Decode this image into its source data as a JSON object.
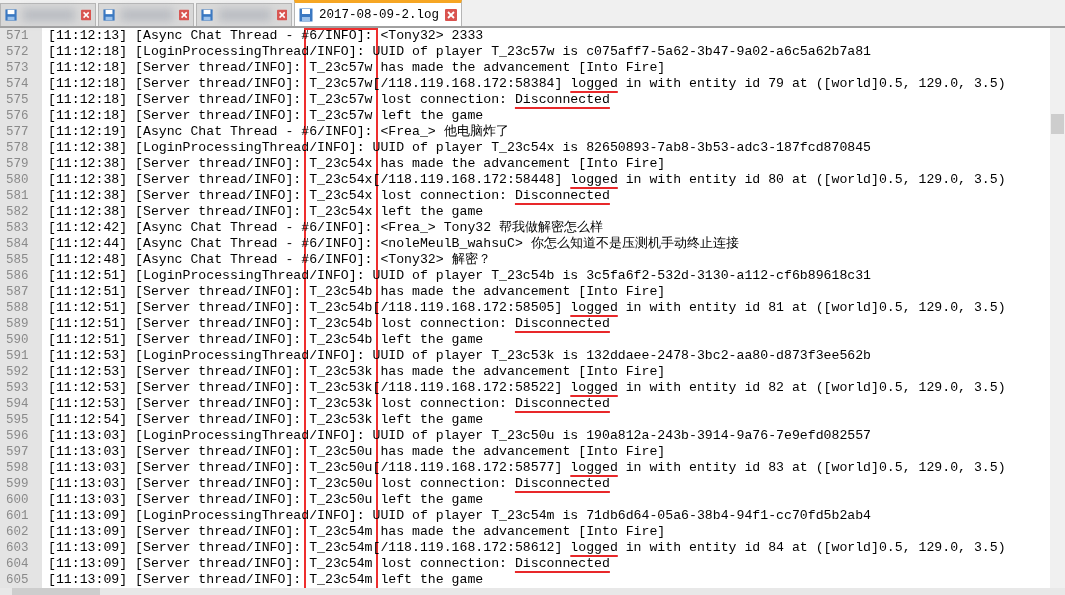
{
  "tabs": [
    {
      "selected": false
    },
    {
      "selected": false
    },
    {
      "selected": false
    },
    {
      "label": "2017-08-09-2.log",
      "selected": true
    }
  ],
  "lines": [
    {
      "n": "571",
      "kind": "plain",
      "text": "[11:12:13] [Async Chat Thread - #6/INFO]: <Tony32> 2333"
    },
    {
      "n": "572",
      "kind": "plain",
      "text": "[11:12:18] [LoginProcessingThread/INFO]: UUID of player T_23c57w is c075aff7-5a62-3b47-9a02-a6c5a62b7a81"
    },
    {
      "n": "573",
      "kind": "plain",
      "text": "[11:12:18] [Server thread/INFO]: T_23c57w has made the advancement [Into Fire]"
    },
    {
      "n": "574",
      "kind": "marked",
      "before": "[11:12:18] [Server thread/INFO]: T_23c57w[/118.119.168.172:58384] ",
      "marked": "logged",
      "after": " in with entity id 79 at ([world]0.5, 129.0, 3.5)"
    },
    {
      "n": "575",
      "kind": "marked",
      "before": "[11:12:18] [Server thread/INFO]: T_23c57w lost connection: ",
      "marked": "Disconnected"
    },
    {
      "n": "576",
      "kind": "plain",
      "text": "[11:12:18] [Server thread/INFO]: T_23c57w left the game"
    },
    {
      "n": "577",
      "kind": "plain",
      "text": "[11:12:19] [Async Chat Thread - #6/INFO]: <Frea_> 他电脑炸了"
    },
    {
      "n": "578",
      "kind": "plain",
      "text": "[11:12:38] [LoginProcessingThread/INFO]: UUID of player T_23c54x is 82650893-7ab8-3b53-adc3-187fcd870845"
    },
    {
      "n": "579",
      "kind": "plain",
      "text": "[11:12:38] [Server thread/INFO]: T_23c54x has made the advancement [Into Fire]"
    },
    {
      "n": "580",
      "kind": "marked",
      "before": "[11:12:38] [Server thread/INFO]: T_23c54x[/118.119.168.172:58448] ",
      "marked": "logged",
      "after": " in with entity id 80 at ([world]0.5, 129.0, 3.5)"
    },
    {
      "n": "581",
      "kind": "marked",
      "before": "[11:12:38] [Server thread/INFO]: T_23c54x lost connection: ",
      "marked": "Disconnected"
    },
    {
      "n": "582",
      "kind": "plain",
      "text": "[11:12:38] [Server thread/INFO]: T_23c54x left the game"
    },
    {
      "n": "583",
      "kind": "plain",
      "text": "[11:12:42] [Async Chat Thread - #6/INFO]: <Frea_> Tony32 帮我做解密怎么样"
    },
    {
      "n": "584",
      "kind": "plain",
      "text": "[11:12:44] [Async Chat Thread - #6/INFO]: <noleMeulB_wahsuC> 你怎么知道不是压测机手动终止连接"
    },
    {
      "n": "585",
      "kind": "plain",
      "text": "[11:12:48] [Async Chat Thread - #6/INFO]: <Tony32> 解密？"
    },
    {
      "n": "586",
      "kind": "plain",
      "text": "[11:12:51] [LoginProcessingThread/INFO]: UUID of player T_23c54b is 3c5fa6f2-532d-3130-a112-cf6b89618c31"
    },
    {
      "n": "587",
      "kind": "plain",
      "text": "[11:12:51] [Server thread/INFO]: T_23c54b has made the advancement [Into Fire]"
    },
    {
      "n": "588",
      "kind": "marked",
      "before": "[11:12:51] [Server thread/INFO]: T_23c54b[/118.119.168.172:58505] ",
      "marked": "logged",
      "after": " in with entity id 81 at ([world]0.5, 129.0, 3.5)"
    },
    {
      "n": "589",
      "kind": "marked",
      "before": "[11:12:51] [Server thread/INFO]: T_23c54b lost connection: ",
      "marked": "Disconnected"
    },
    {
      "n": "590",
      "kind": "plain",
      "text": "[11:12:51] [Server thread/INFO]: T_23c54b left the game"
    },
    {
      "n": "591",
      "kind": "plain",
      "text": "[11:12:53] [LoginProcessingThread/INFO]: UUID of player T_23c53k is 132ddaee-2478-3bc2-aa80-d873f3ee562b"
    },
    {
      "n": "592",
      "kind": "plain",
      "text": "[11:12:53] [Server thread/INFO]: T_23c53k has made the advancement [Into Fire]"
    },
    {
      "n": "593",
      "kind": "marked",
      "before": "[11:12:53] [Server thread/INFO]: T_23c53k[/118.119.168.172:58522] ",
      "marked": "logged",
      "after": " in with entity id 82 at ([world]0.5, 129.0, 3.5)"
    },
    {
      "n": "594",
      "kind": "marked",
      "before": "[11:12:53] [Server thread/INFO]: T_23c53k lost connection: ",
      "marked": "Disconnected"
    },
    {
      "n": "595",
      "kind": "plain",
      "text": "[11:12:54] [Server thread/INFO]: T_23c53k left the game"
    },
    {
      "n": "596",
      "kind": "plain",
      "text": "[11:13:03] [LoginProcessingThread/INFO]: UUID of player T_23c50u is 190a812a-243b-3914-9a76-7e9efd082557"
    },
    {
      "n": "597",
      "kind": "plain",
      "text": "[11:13:03] [Server thread/INFO]: T_23c50u has made the advancement [Into Fire]"
    },
    {
      "n": "598",
      "kind": "marked",
      "before": "[11:13:03] [Server thread/INFO]: T_23c50u[/118.119.168.172:58577] ",
      "marked": "logged",
      "after": " in with entity id 83 at ([world]0.5, 129.0, 3.5)"
    },
    {
      "n": "599",
      "kind": "marked",
      "before": "[11:13:03] [Server thread/INFO]: T_23c50u lost connection: ",
      "marked": "Disconnected"
    },
    {
      "n": "600",
      "kind": "plain",
      "text": "[11:13:03] [Server thread/INFO]: T_23c50u left the game"
    },
    {
      "n": "601",
      "kind": "plain",
      "text": "[11:13:09] [LoginProcessingThread/INFO]: UUID of player T_23c54m is 71db6d64-05a6-38b4-94f1-cc70fd5b2ab4"
    },
    {
      "n": "602",
      "kind": "plain",
      "text": "[11:13:09] [Server thread/INFO]: T_23c54m has made the advancement [Into Fire]"
    },
    {
      "n": "603",
      "kind": "marked",
      "before": "[11:13:09] [Server thread/INFO]: T_23c54m[/118.119.168.172:58612] ",
      "marked": "logged",
      "after": " in with entity id 84 at ([world]0.5, 129.0, 3.5)"
    },
    {
      "n": "604",
      "kind": "marked",
      "before": "[11:13:09] [Server thread/INFO]: T_23c54m lost connection: ",
      "marked": "Disconnected"
    },
    {
      "n": "605",
      "kind": "plain",
      "text": "[11:13:09] [Server thread/INFO]: T_23c54m left the game"
    }
  ]
}
